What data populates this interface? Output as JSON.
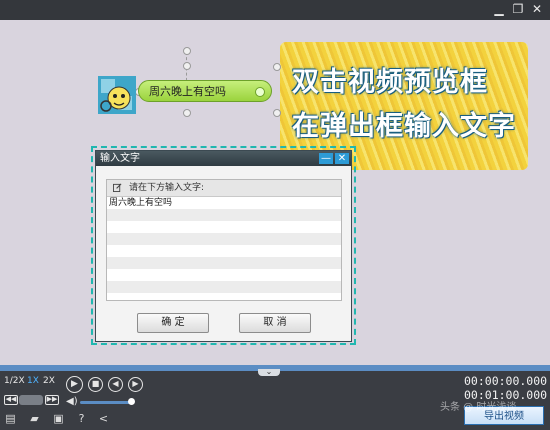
{
  "window": {
    "controls": [
      "minimize",
      "restore",
      "close"
    ]
  },
  "banner": {
    "line1": "双击视频预览框",
    "line2": "在弹出框输入文字"
  },
  "caption": {
    "text": "周六晚上有空吗"
  },
  "dialog": {
    "title": "输入文字",
    "prompt": "请在下方输入文字:",
    "rows": [
      "周六晚上有空吗",
      "",
      "",
      "",
      "",
      "",
      "",
      ""
    ],
    "ok": "确 定",
    "cancel": "取 消"
  },
  "player": {
    "speeds": [
      "1/2X",
      "1X",
      "2X"
    ],
    "current_time": "00:00:00.000",
    "total_time": "00:01:00.000",
    "volume": 0.9
  },
  "toolbar": {
    "export_label": "导出视频"
  },
  "watermark": "头条 @ 时光浅谈"
}
